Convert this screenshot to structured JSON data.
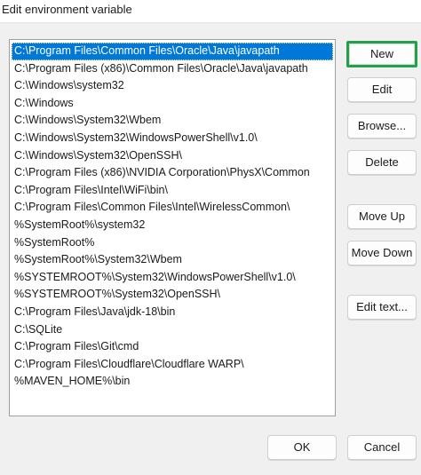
{
  "window": {
    "title": "Edit environment variable"
  },
  "path_list": {
    "selected_index": 0,
    "items": [
      "C:\\Program Files\\Common Files\\Oracle\\Java\\javapath",
      "C:\\Program Files (x86)\\Common Files\\Oracle\\Java\\javapath",
      "C:\\Windows\\system32",
      "C:\\Windows",
      "C:\\Windows\\System32\\Wbem",
      "C:\\Windows\\System32\\WindowsPowerShell\\v1.0\\",
      "C:\\Windows\\System32\\OpenSSH\\",
      "C:\\Program Files (x86)\\NVIDIA Corporation\\PhysX\\Common",
      "C:\\Program Files\\Intel\\WiFi\\bin\\",
      "C:\\Program Files\\Common Files\\Intel\\WirelessCommon\\",
      "%SystemRoot%\\system32",
      "%SystemRoot%",
      "%SystemRoot%\\System32\\Wbem",
      "%SYSTEMROOT%\\System32\\WindowsPowerShell\\v1.0\\",
      "%SYSTEMROOT%\\System32\\OpenSSH\\",
      "C:\\Program Files\\Java\\jdk-18\\bin",
      "C:\\SQLite",
      "C:\\Program Files\\Git\\cmd",
      "C:\\Program Files\\Cloudflare\\Cloudflare WARP\\",
      "%MAVEN_HOME%\\bin"
    ]
  },
  "buttons": {
    "new": "New",
    "edit": "Edit",
    "browse": "Browse...",
    "delete": "Delete",
    "move_up": "Move Up",
    "move_down": "Move Down",
    "edit_text": "Edit text...",
    "ok": "OK",
    "cancel": "Cancel"
  },
  "colors": {
    "selection": "#0078d7",
    "highlight_border": "#23a04a"
  }
}
